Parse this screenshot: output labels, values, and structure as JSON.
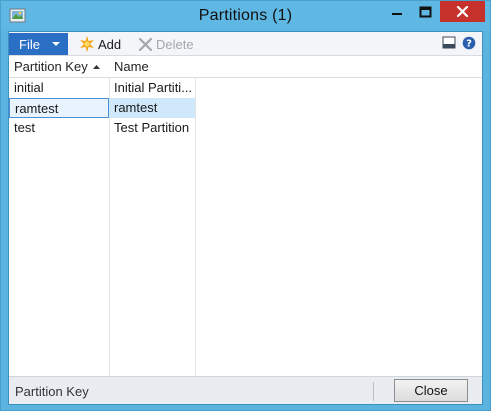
{
  "window": {
    "title": "Partitions (1)"
  },
  "toolbar": {
    "file_label": "File",
    "add_label": "Add",
    "delete_label": "Delete"
  },
  "grid": {
    "columns": [
      "Partition Key",
      "Name"
    ],
    "sort": "ascending",
    "rows": [
      {
        "key": "initial",
        "name": "Initial Partiti..."
      },
      {
        "key": "ramtest",
        "name": "ramtest"
      },
      {
        "key": "test",
        "name": "Test Partition"
      }
    ],
    "selected_row": 1
  },
  "statusbar": {
    "text": "Partition Key",
    "close_label": "Close"
  },
  "colors": {
    "frame": "#5fb8e3",
    "file_button": "#2b6fc5",
    "close_button": "#c7312b",
    "selection": "#cfe8fa"
  }
}
